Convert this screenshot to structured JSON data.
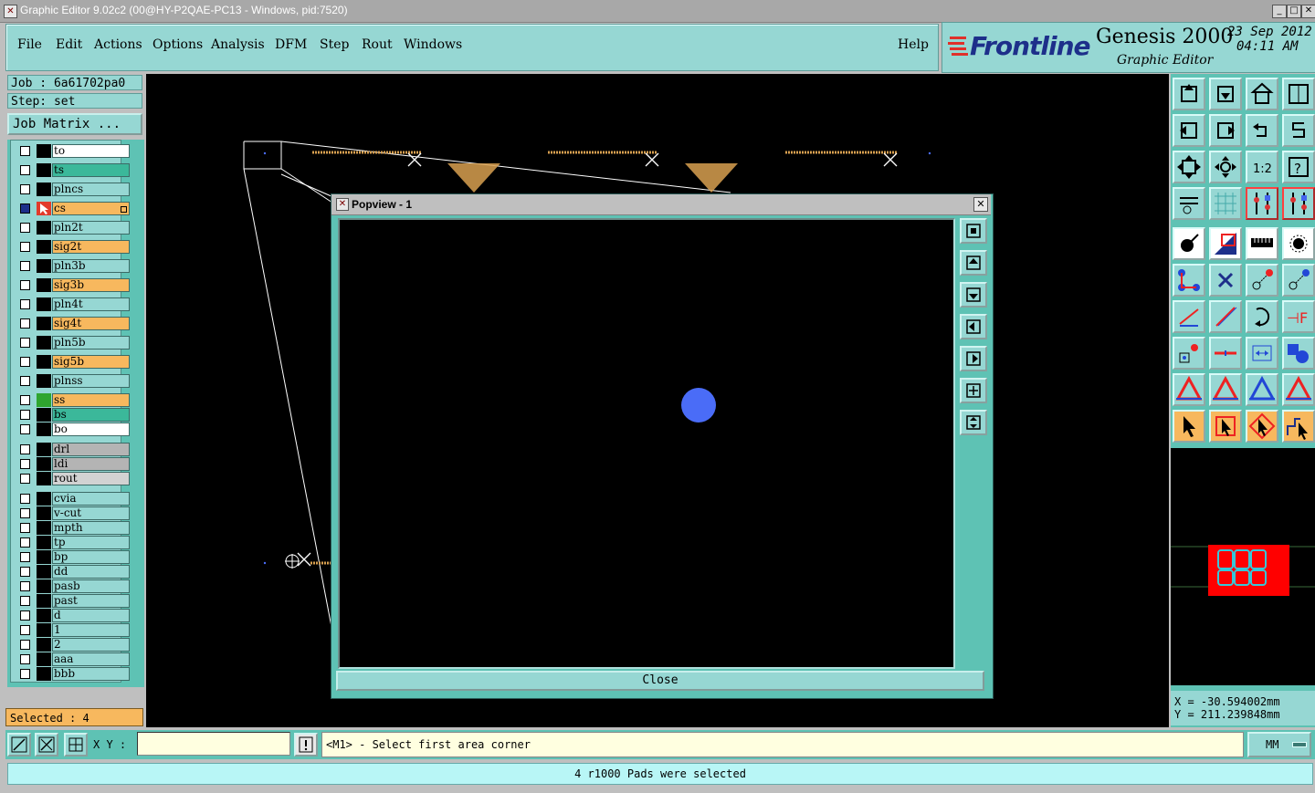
{
  "window": {
    "title": "Graphic Editor 9.02c2 (00@HY-P2QAE-PC13 - Windows, pid:7520)",
    "controls": [
      "_",
      "□",
      "✕"
    ]
  },
  "menu": {
    "items": [
      "File",
      "Edit",
      "Actions",
      "Options",
      "Analysis",
      "DFM",
      "Step",
      "Rout",
      "Windows"
    ],
    "help": "Help"
  },
  "brand": {
    "logo": "Frontline",
    "product": "Genesis 2000",
    "subtitle": "Graphic Editor",
    "date": "23 Sep 2012",
    "time": "04:11 AM"
  },
  "job": {
    "job_label": "Job : 6a61702pa0",
    "step_label": "Step: set",
    "job_matrix_button": "Job Matrix ..."
  },
  "layers": [
    {
      "name": "to",
      "color": "#ffffff",
      "icon": ""
    },
    {
      "name": "ts",
      "color": "#3bb89a",
      "icon": ""
    },
    {
      "name": "plncs",
      "color": "#96d7d3",
      "icon": ""
    },
    {
      "name": "cs",
      "color": "#f7b85e",
      "icon": "work-layer"
    },
    {
      "name": "pln2t",
      "color": "#96d7d3",
      "icon": ""
    },
    {
      "name": "sig2t",
      "color": "#f7b85e",
      "icon": ""
    },
    {
      "name": "pln3b",
      "color": "#96d7d3",
      "icon": ""
    },
    {
      "name": "sig3b",
      "color": "#f7b85e",
      "icon": ""
    },
    {
      "name": "pln4t",
      "color": "#96d7d3",
      "icon": ""
    },
    {
      "name": "sig4t",
      "color": "#f7b85e",
      "icon": ""
    },
    {
      "name": "pln5b",
      "color": "#96d7d3",
      "icon": ""
    },
    {
      "name": "sig5b",
      "color": "#f7b85e",
      "icon": ""
    },
    {
      "name": "plnss",
      "color": "#96d7d3",
      "icon": ""
    },
    {
      "name": "ss",
      "color": "#f7b85e",
      "icon": "green"
    },
    {
      "name": "bs",
      "color": "#3bb89a",
      "icon": ""
    },
    {
      "name": "bo",
      "color": "#ffffff",
      "icon": ""
    },
    {
      "name": "drl",
      "color": "#b4b4b4",
      "icon": ""
    },
    {
      "name": "ldi",
      "color": "#b4b4b4",
      "icon": ""
    },
    {
      "name": "rout",
      "color": "#d2d2d2",
      "icon": ""
    },
    {
      "name": "cvia",
      "color": "#96d7d3",
      "icon": ""
    },
    {
      "name": "v-cut",
      "color": "#96d7d3",
      "icon": ""
    },
    {
      "name": "mpth",
      "color": "#96d7d3",
      "icon": ""
    },
    {
      "name": "tp",
      "color": "#96d7d3",
      "icon": ""
    },
    {
      "name": "bp",
      "color": "#96d7d3",
      "icon": ""
    },
    {
      "name": "dd",
      "color": "#96d7d3",
      "icon": ""
    },
    {
      "name": "pasb",
      "color": "#96d7d3",
      "icon": ""
    },
    {
      "name": "past",
      "color": "#96d7d3",
      "icon": ""
    },
    {
      "name": "d",
      "color": "#96d7d3",
      "icon": ""
    },
    {
      "name": "1",
      "color": "#96d7d3",
      "icon": ""
    },
    {
      "name": "2",
      "color": "#96d7d3",
      "icon": ""
    },
    {
      "name": "aaa",
      "color": "#96d7d3",
      "icon": ""
    },
    {
      "name": "bbb",
      "color": "#96d7d3",
      "icon": ""
    }
  ],
  "selected": "Selected : 4",
  "popview": {
    "title": "Popview - 1",
    "close_label": "Close",
    "pad_color": "#4a6cf7"
  },
  "coords": {
    "x": "X = -30.594002mm",
    "y": "Y = 211.239848mm"
  },
  "bottom": {
    "xy_label": "X Y :",
    "xy_value": "",
    "prompt": "<M1> - Select first area corner",
    "units": "MM",
    "status": "4 r1000 Pads were selected"
  },
  "colors": {
    "panel": "#96d7d3",
    "panel_dark": "#5ec2b4",
    "signal_layer": "#f7b85e",
    "highlight": "#ff0000"
  }
}
